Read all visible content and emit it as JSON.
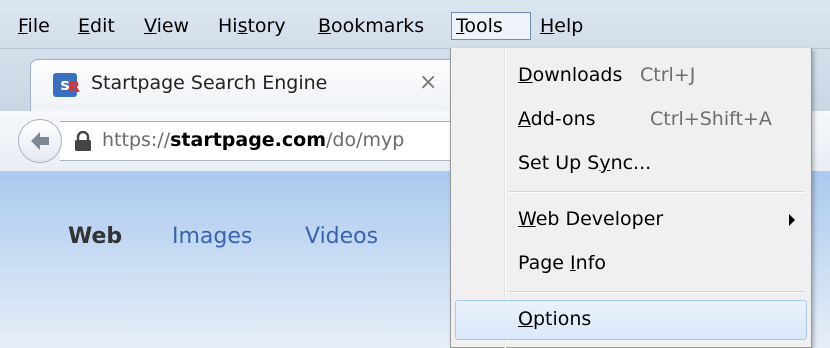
{
  "menubar": {
    "items": [
      {
        "mnemonic": "F",
        "rest": "ile"
      },
      {
        "mnemonic": "E",
        "rest": "dit"
      },
      {
        "mnemonic": "V",
        "rest": "iew"
      },
      {
        "pre": "Hi",
        "mnemonic": "s",
        "rest": "tory"
      },
      {
        "mnemonic": "B",
        "rest": "ookmarks"
      },
      {
        "mnemonic": "T",
        "rest": "ools"
      },
      {
        "mnemonic": "H",
        "rest": "elp"
      }
    ]
  },
  "tab": {
    "title": "Startpage Search Engine",
    "close_glyph": "×",
    "favicon_glyph": "s",
    "favicon_badge": "R"
  },
  "navbar": {
    "url_prefix": "https://",
    "url_domain": "startpage.com",
    "url_path": "/do/myp"
  },
  "page": {
    "nav": [
      "Web",
      "Images",
      "Videos"
    ]
  },
  "tools_menu": {
    "downloads": {
      "mnemonic": "D",
      "rest": "ownloads",
      "shortcut": "Ctrl+J"
    },
    "addons": {
      "mnemonic": "A",
      "rest": "dd-ons",
      "shortcut": "Ctrl+Shift+A"
    },
    "sync": {
      "pre": "Set Up S",
      "mnemonic": "y",
      "rest": "nc..."
    },
    "webdev": {
      "mnemonic": "W",
      "rest": "eb Developer"
    },
    "pageinfo": {
      "pre": "Page ",
      "mnemonic": "I",
      "rest": "nfo"
    },
    "options": {
      "mnemonic": "O",
      "rest": "ptions"
    }
  }
}
